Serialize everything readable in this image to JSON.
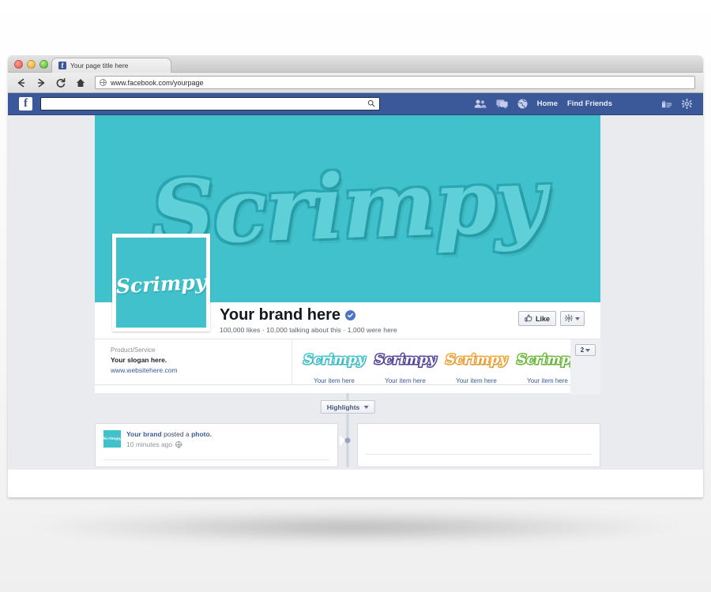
{
  "browser": {
    "tab_title": "Your page title here",
    "tab_favicon": "facebook-f-icon",
    "url": "www.facebook.com/yourpage",
    "nav": {
      "back": "back-arrow-icon",
      "forward": "forward-arrow-icon",
      "reload": "reload-icon",
      "home": "home-icon"
    },
    "traffic_lights": [
      "close",
      "minimize",
      "zoom"
    ]
  },
  "fbnav": {
    "logo": "facebook-f-icon",
    "search_placeholder": "",
    "search_value": "",
    "search_icon": "search-icon",
    "icons": [
      "friend-requests-icon",
      "messages-icon",
      "notifications-icon"
    ],
    "links": [
      {
        "label": "Home"
      },
      {
        "label": "Find Friends"
      }
    ],
    "right_icons": [
      "privacy-shortcuts-icon",
      "settings-gear-icon"
    ]
  },
  "cover": {
    "brand_word": "Scrimpy",
    "bg_color": "#40c1cb",
    "word_color": "#5fd0d8",
    "word_outline": "#2fb0bb"
  },
  "avatar": {
    "brand_word": "Scrimpy",
    "bg_color": "#40c1cb"
  },
  "profile": {
    "name": "Your brand here",
    "verified_icon": "verified-check-icon",
    "stats": "100,000 likes · 10,000 talking about this · 1,000 were here",
    "like_button": "Like",
    "like_icon": "thumbs-up-icon",
    "settings_icon": "gear-icon"
  },
  "info": {
    "category": "Product/Service",
    "slogan": "Your slogan here.",
    "website": "www.websitehere.com"
  },
  "items": {
    "count_badge": "2",
    "list": [
      {
        "logo_text": "Scrimpy",
        "label": "Your item here",
        "color": "#45c6d0"
      },
      {
        "logo_text": "Scrimpy",
        "label": "Your item here",
        "color": "#5b4a9e"
      },
      {
        "logo_text": "Scrimpy",
        "label": "Your item here",
        "color": "#f2a93b"
      },
      {
        "logo_text": "Scrimpy",
        "label": "Your item here",
        "color": "#73bf45"
      }
    ]
  },
  "highlights": {
    "label": "Highlights",
    "caret_icon": "chevron-down-icon"
  },
  "post": {
    "author": "Your brand",
    "action_text": "posted a",
    "object": "photo.",
    "time": "10 minutes ago",
    "privacy_icon": "globe-icon"
  },
  "colors": {
    "facebook_blue": "#3b5998",
    "page_bg": "#e9ebee",
    "brand_teal": "#40c1cb",
    "link_blue": "#3b5998"
  }
}
